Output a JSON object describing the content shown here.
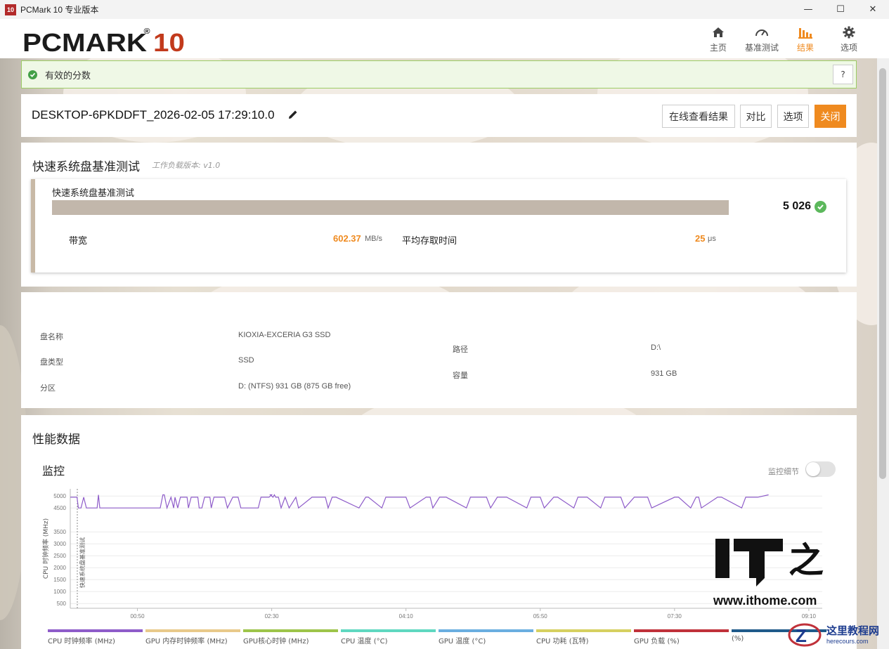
{
  "window": {
    "icon_text": "10",
    "title": "PCMark 10 专业版本",
    "minimize": "—",
    "maximize": "☐",
    "close": "✕"
  },
  "header": {
    "logo_main": "PCMARK",
    "logo_ten": "10",
    "logo_reg": "®",
    "nav": [
      {
        "label": "主页",
        "icon": "home-icon"
      },
      {
        "label": "基准测试",
        "icon": "gauge-icon"
      },
      {
        "label": "结果",
        "icon": "bar-chart-icon",
        "active": true
      },
      {
        "label": "选项",
        "icon": "gear-icon"
      }
    ]
  },
  "banner": {
    "text": "有效的分数",
    "help": "?"
  },
  "result": {
    "name": "DESKTOP-6PKDDFT_2026-02-05 17:29:10.0",
    "buttons": {
      "online": "在线查看结果",
      "compare": "对比",
      "options": "选项",
      "close": "关闭"
    }
  },
  "benchmark": {
    "title": "快速系统盘基准测试",
    "version": "工作负载版本: v1.0",
    "inner_title": "快速系统盘基准测试",
    "score": "5 026",
    "bandwidth_label": "带宽",
    "bandwidth_value": "602.37",
    "bandwidth_unit": "MB/s",
    "access_label": "平均存取时间",
    "access_value": "25",
    "access_unit": "μs"
  },
  "drive": {
    "name_label": "盘名称",
    "name_value": "KIOXIA-EXCERIA G3 SSD",
    "type_label": "盘类型",
    "type_value": "SSD",
    "partition_label": "分区",
    "partition_value": "D: (NTFS) 931 GB (875 GB free)",
    "path_label": "路径",
    "path_value": "D:\\",
    "capacity_label": "容量",
    "capacity_value": "931 GB"
  },
  "performance": {
    "title": "性能数据",
    "monitor_title": "监控",
    "toggle_label": "监控细节",
    "legend": [
      {
        "label": "CPU 时钟频率 (MHz)",
        "color": "#8e5cc9"
      },
      {
        "label": "GPU 内存时钟频率 (MHz)",
        "color": "#e8c98a"
      },
      {
        "label": "GPU核心时钟 (MHz)",
        "color": "#9dc44a"
      },
      {
        "label": "CPU 温度 (°C)",
        "color": "#5fd8c0"
      },
      {
        "label": "GPU 温度 (°C)",
        "color": "#6aaee0"
      },
      {
        "label": "CPU 功耗 (瓦特)",
        "color": "#d6d060"
      },
      {
        "label": "GPU 负载 (%)",
        "color": "#c0313a"
      },
      {
        "label": "(%)",
        "color": "#1f5a8a"
      }
    ]
  },
  "chart_data": {
    "type": "line",
    "ylabel": "CPU 时钟频率 (MHz)",
    "marker_label": "快速系统盘基准测试",
    "yticks": [
      500,
      1000,
      1500,
      2000,
      2500,
      3000,
      3500,
      4500,
      5000
    ],
    "ylim": [
      300,
      5300
    ],
    "xticks": [
      "00:50",
      "02:30",
      "04:10",
      "05:50",
      "07:30",
      "09:10"
    ],
    "xtick_seconds": [
      50,
      150,
      250,
      350,
      450,
      550
    ],
    "xlim": [
      0,
      560
    ],
    "series": [
      {
        "name": "CPU 时钟频率 (MHz)",
        "color": "#8e5cc9",
        "x": [
          0,
          5,
          6,
          8,
          10,
          12,
          20,
          21,
          22,
          23,
          67,
          69,
          70,
          72,
          75,
          77,
          78,
          80,
          82,
          87,
          88,
          90,
          95,
          96,
          98,
          100,
          104,
          105,
          107,
          115,
          117,
          121,
          125,
          127,
          140,
          142,
          148,
          150,
          149,
          151,
          152,
          153,
          155,
          157,
          160,
          163,
          168,
          170,
          180,
          190,
          192,
          195,
          198,
          215,
          220,
          222,
          232,
          235,
          250,
          253,
          265,
          268,
          270,
          275,
          280,
          295,
          298,
          310,
          313,
          318,
          325,
          340,
          343,
          350,
          353,
          360,
          363,
          375,
          378,
          385,
          395,
          398,
          410,
          413,
          420,
          430,
          433,
          450,
          453,
          462,
          466,
          468,
          470,
          482,
          485,
          500,
          503,
          512,
          520
        ],
        "y": [
          4950,
          4950,
          4500,
          4500,
          4950,
          4500,
          4500,
          5050,
          4500,
          4500,
          4500,
          5050,
          5050,
          4500,
          4950,
          4500,
          4950,
          4500,
          4950,
          4950,
          4500,
          4950,
          4950,
          4500,
          4500,
          4950,
          4950,
          4500,
          4950,
          4950,
          4500,
          4950,
          4950,
          4500,
          4500,
          4950,
          4950,
          5050,
          5050,
          4950,
          5050,
          4950,
          4950,
          4500,
          4950,
          4500,
          4950,
          4500,
          4950,
          4950,
          4500,
          4950,
          4950,
          4500,
          4950,
          4950,
          4500,
          4950,
          4950,
          4500,
          4950,
          4950,
          4500,
          4950,
          4950,
          4500,
          4950,
          4950,
          4500,
          4950,
          4950,
          4500,
          4950,
          4950,
          4500,
          4950,
          4950,
          4500,
          4950,
          4950,
          4500,
          4950,
          4950,
          4500,
          4950,
          4950,
          4500,
          4950,
          4950,
          4500,
          4950,
          4950,
          4500,
          4950,
          4950,
          4500,
          4950,
          4950,
          5050
        ]
      }
    ]
  },
  "watermarks": {
    "url": "www.ithome.com",
    "site2_cn": "这里教程网",
    "site2_en": "herecours.com"
  }
}
